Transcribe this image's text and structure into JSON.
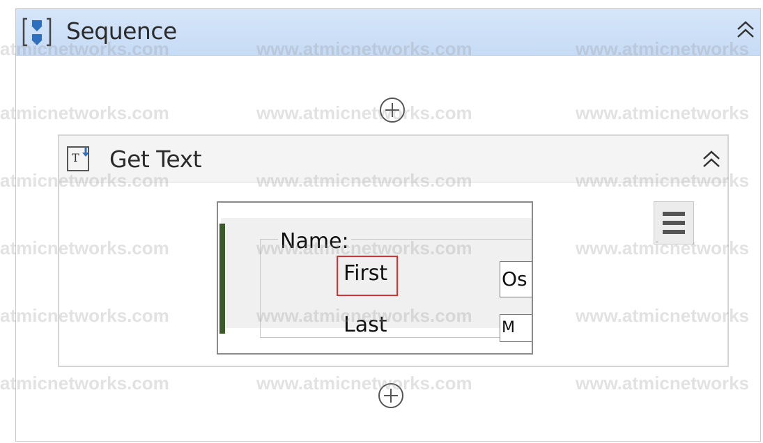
{
  "sequence": {
    "title": "Sequence",
    "icon": "sequence-icon",
    "collapse_icon": "double-chevron-up-icon"
  },
  "add_icon": "plus-circle-icon",
  "get_text": {
    "title": "Get Text",
    "icon": "get-text-icon",
    "collapse_icon": "double-chevron-up-icon",
    "menu_icon": "hamburger-menu-icon",
    "preview": {
      "group_label": "Name:",
      "first_label": "First",
      "last_label": "Last",
      "first_value": "Os",
      "last_value": "M",
      "highlight_color": "#d93131"
    }
  },
  "watermark": {
    "text_left": "atmicnetworks.com",
    "text_mid": "www.atmicnetworks.com",
    "text_right": "www.atmicnetworks"
  },
  "colors": {
    "sequence_header": "#c6dbf5",
    "get_text_header": "#f4f4f4",
    "icon_blue": "#2f6fbf"
  }
}
